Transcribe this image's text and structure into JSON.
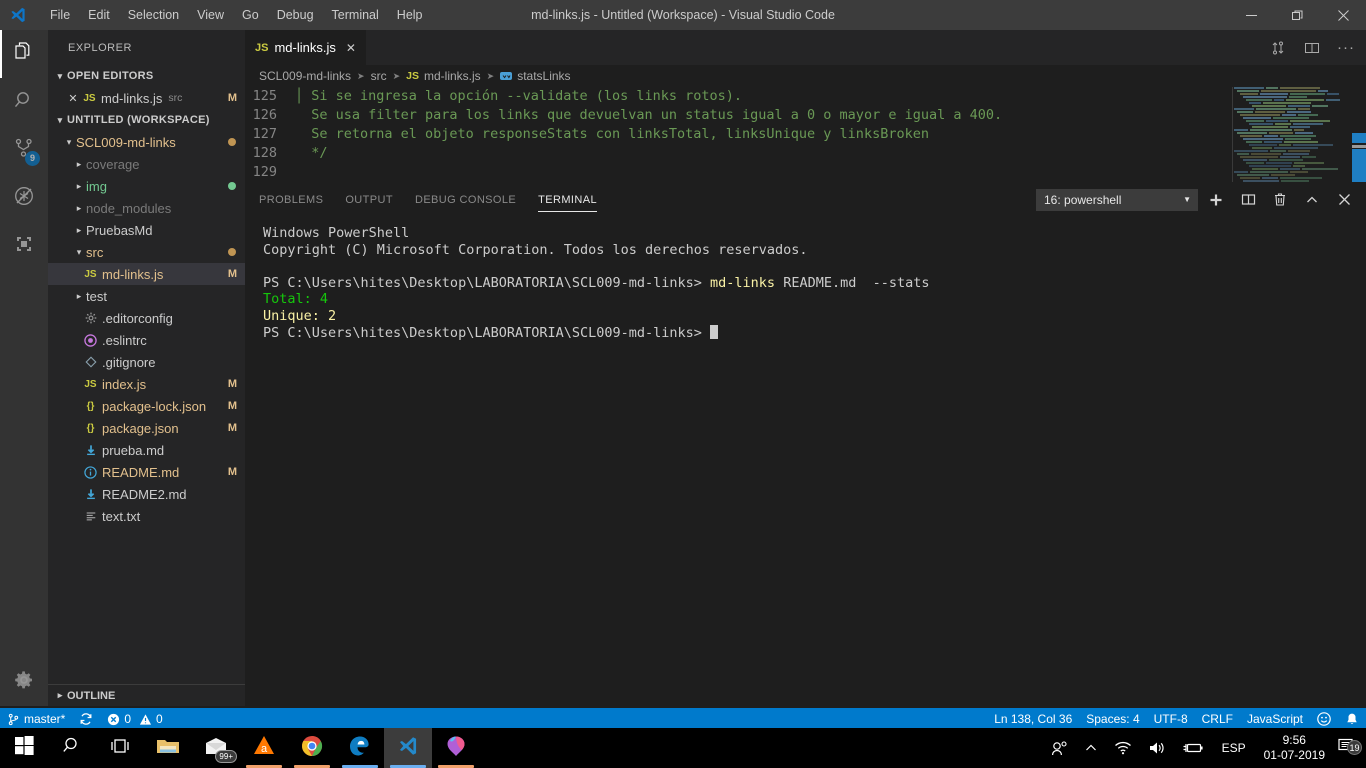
{
  "titlebar": {
    "title": "md-links.js - Untitled (Workspace) - Visual Studio Code",
    "logo_icon": "vscode-logo-icon",
    "menus": [
      "File",
      "Edit",
      "Selection",
      "View",
      "Go",
      "Debug",
      "Terminal",
      "Help"
    ],
    "window_controls": [
      {
        "name": "minimize-button",
        "glyph": "─"
      },
      {
        "name": "maximize-button",
        "glyph": "❐"
      },
      {
        "name": "close-button",
        "glyph": "✕"
      }
    ]
  },
  "activitybar": {
    "items": [
      {
        "name": "explorer",
        "icon": "files-icon",
        "active": true,
        "badge": ""
      },
      {
        "name": "search",
        "icon": "search-icon",
        "active": false,
        "badge": ""
      },
      {
        "name": "source-control",
        "icon": "source-control-icon",
        "active": false,
        "badge": "9"
      },
      {
        "name": "debug",
        "icon": "debug-icon",
        "active": false,
        "badge": ""
      },
      {
        "name": "extensions",
        "icon": "extensions-icon",
        "active": false,
        "badge": ""
      }
    ],
    "settings_icon": "gear-icon"
  },
  "sidebar": {
    "title": "EXPLORER",
    "open_editors": {
      "label": "OPEN EDITORS",
      "items": [
        {
          "icon": "js-file-icon",
          "name": "md-links.js",
          "sub": "src",
          "status": "M"
        }
      ]
    },
    "workspace": {
      "label": "UNTITLED (WORKSPACE)",
      "items": [
        {
          "icon": "folder-open",
          "name": "SCL009-md-links",
          "indent": 1,
          "expanded": true,
          "status": "",
          "dot": "#c09553",
          "color": "#e2c08d",
          "bold": false
        },
        {
          "icon": "folder",
          "name": "coverage",
          "indent": 2,
          "expanded": false,
          "status": "",
          "dot": "",
          "color": "#7a7a7a",
          "bold": false
        },
        {
          "icon": "folder",
          "name": "img",
          "indent": 2,
          "expanded": false,
          "status": "",
          "dot": "#73c991",
          "color": "#73c991",
          "bold": false
        },
        {
          "icon": "folder",
          "name": "node_modules",
          "indent": 2,
          "expanded": false,
          "status": "",
          "dot": "",
          "color": "#7a7a7a",
          "bold": false
        },
        {
          "icon": "folder",
          "name": "PruebasMd",
          "indent": 2,
          "expanded": false,
          "status": "",
          "dot": "",
          "color": "#cccccc",
          "bold": false
        },
        {
          "icon": "folder-open",
          "name": "src",
          "indent": 2,
          "expanded": true,
          "status": "",
          "dot": "#c09553",
          "color": "#e2c08d",
          "bold": false
        },
        {
          "icon": "js-file-icon",
          "name": "md-links.js",
          "indent": 3,
          "expanded": null,
          "status": "M",
          "dot": "",
          "color": "#e2c08d",
          "bold": false,
          "selected": true
        },
        {
          "icon": "folder",
          "name": "test",
          "indent": 2,
          "expanded": false,
          "status": "",
          "dot": "",
          "color": "#cccccc",
          "bold": false
        },
        {
          "icon": "gear-file-icon",
          "name": ".editorconfig",
          "indent": 3,
          "expanded": null,
          "status": "",
          "dot": "",
          "color": "#cccccc",
          "bold": false
        },
        {
          "icon": "eslint-icon",
          "name": ".eslintrc",
          "indent": 3,
          "expanded": null,
          "status": "",
          "dot": "",
          "color": "#cccccc",
          "bold": false
        },
        {
          "icon": "git-icon",
          "name": ".gitignore",
          "indent": 3,
          "expanded": null,
          "status": "",
          "dot": "",
          "color": "#cccccc",
          "bold": false
        },
        {
          "icon": "js-file-icon",
          "name": "index.js",
          "indent": 3,
          "expanded": null,
          "status": "M",
          "dot": "",
          "color": "#e2c08d",
          "bold": false
        },
        {
          "icon": "json-icon",
          "name": "package-lock.json",
          "indent": 3,
          "expanded": null,
          "status": "M",
          "dot": "",
          "color": "#e2c08d",
          "bold": false
        },
        {
          "icon": "json-icon",
          "name": "package.json",
          "indent": 3,
          "expanded": null,
          "status": "M",
          "dot": "",
          "color": "#e2c08d",
          "bold": false
        },
        {
          "icon": "markdown-icon",
          "name": "prueba.md",
          "indent": 3,
          "expanded": null,
          "status": "",
          "dot": "",
          "color": "#cccccc",
          "bold": false
        },
        {
          "icon": "info-icon",
          "name": "README.md",
          "indent": 3,
          "expanded": null,
          "status": "M",
          "dot": "",
          "color": "#e2c08d",
          "bold": false
        },
        {
          "icon": "markdown-icon",
          "name": "README2.md",
          "indent": 3,
          "expanded": null,
          "status": "",
          "dot": "",
          "color": "#cccccc",
          "bold": false
        },
        {
          "icon": "text-file-icon",
          "name": "text.txt",
          "indent": 3,
          "expanded": null,
          "status": "",
          "dot": "",
          "color": "#cccccc",
          "bold": false
        }
      ]
    },
    "outline_label": "OUTLINE"
  },
  "editor": {
    "tab": {
      "icon": "js-file-icon",
      "label": "md-links.js",
      "close": "✕"
    },
    "actions": [
      {
        "name": "split-editor-vertical-icon",
        "glyph": "sync"
      },
      {
        "name": "split-editor-icon",
        "glyph": "split"
      },
      {
        "name": "more-actions-icon",
        "glyph": "···"
      }
    ],
    "breadcrumb": [
      "SCL009-md-links",
      "src",
      "md-links.js",
      "statsLinks"
    ],
    "breadcrumb_file_icon": "js-file-icon",
    "breadcrumb_symbol_icon": "method-symbol-icon",
    "lines": [
      {
        "num": "125",
        "text": "Si se ingresa la opción --validate (los links rotos).",
        "guide": true
      },
      {
        "num": "126",
        "text": "Se usa filter para los links que devuelvan un status igual a 0 o mayor e igual a 400.",
        "guide": false
      },
      {
        "num": "127",
        "text": "Se retorna el objeto responseStats con linksTotal, linksUnique y linksBroken",
        "guide": false
      },
      {
        "num": "128",
        "text": "*/",
        "guide": false
      },
      {
        "num": "129",
        "text": "",
        "guide": false
      }
    ]
  },
  "panel": {
    "tabs": [
      {
        "label": "PROBLEMS",
        "active": false
      },
      {
        "label": "OUTPUT",
        "active": false
      },
      {
        "label": "DEBUG CONSOLE",
        "active": false
      },
      {
        "label": "TERMINAL",
        "active": true
      }
    ],
    "terminal_select": "16: powershell",
    "actions": [
      {
        "name": "new-terminal-button",
        "glyph": "+"
      },
      {
        "name": "split-terminal-button",
        "glyph": "split"
      },
      {
        "name": "kill-terminal-button",
        "glyph": "trash"
      },
      {
        "name": "maximize-panel-button",
        "glyph": "⌃"
      },
      {
        "name": "close-panel-button",
        "glyph": "✕"
      }
    ],
    "terminal_lines": [
      [
        {
          "t": "Windows PowerShell",
          "c": "plain"
        }
      ],
      [
        {
          "t": "Copyright (C) Microsoft Corporation. Todos los derechos reservados.",
          "c": "plain"
        }
      ],
      [
        {
          "t": "",
          "c": "plain"
        }
      ],
      [
        {
          "t": "PS C:\\Users\\hites\\Desktop\\LABORATORIA\\SCL009-md-links> ",
          "c": "plain"
        },
        {
          "t": "md-links",
          "c": "cmd"
        },
        {
          "t": " README.md  --stats",
          "c": "plain"
        }
      ],
      [
        {
          "t": "Total: ",
          "c": "green"
        },
        {
          "t": "4",
          "c": "green"
        }
      ],
      [
        {
          "t": "Unique: ",
          "c": "yellow"
        },
        {
          "t": "2",
          "c": "yellow"
        }
      ],
      [
        {
          "t": "PS C:\\Users\\hites\\Desktop\\LABORATORIA\\SCL009-md-links> ",
          "c": "plain"
        },
        {
          "t": "CURSOR",
          "c": "cursor"
        }
      ]
    ]
  },
  "statusbar": {
    "branch": "master*",
    "branch_icon": "source-control-icon",
    "sync_icon": "sync-icon",
    "errors_icon": "error-icon",
    "errors": "0",
    "warnings_icon": "warning-icon",
    "warnings": "0",
    "position": "Ln 138, Col 36",
    "indent": "Spaces: 4",
    "encoding": "UTF-8",
    "eol": "CRLF",
    "language": "JavaScript",
    "feedback_icon": "smiley-icon",
    "bell_icon": "bell-icon",
    "accent": "#007acc"
  },
  "taskbar": {
    "items": [
      {
        "name": "start-button",
        "icon": "windows-logo-icon",
        "active": false,
        "underline": ""
      },
      {
        "name": "search-taskbar-button",
        "icon": "search-icon",
        "active": false,
        "underline": ""
      },
      {
        "name": "task-view-button",
        "icon": "task-view-icon",
        "active": false,
        "underline": ""
      },
      {
        "name": "file-explorer-button",
        "icon": "folder-icon",
        "active": false,
        "underline": ""
      },
      {
        "name": "mail-button",
        "icon": "mail-icon",
        "active": false,
        "underline": "",
        "badge": "99+"
      },
      {
        "name": "avast-button",
        "icon": "avast-icon",
        "active": false,
        "underline": "#f0a06a"
      },
      {
        "name": "chrome-button",
        "icon": "chrome-icon",
        "active": false,
        "underline": "#f0a06a"
      },
      {
        "name": "edge-button",
        "icon": "edge-icon",
        "active": false,
        "underline": "#6aaef0"
      },
      {
        "name": "vscode-button",
        "icon": "vscode-logo-icon",
        "active": true,
        "underline": "#6aaef0"
      },
      {
        "name": "paint3d-button",
        "icon": "paint3d-icon",
        "active": false,
        "underline": "#f0a06a"
      }
    ],
    "tray": {
      "people_icon": "people-icon",
      "chevron_icon": "show-hidden-icons-icon",
      "network_icon": "wifi-icon",
      "volume_icon": "volume-icon",
      "battery_icon": "battery-charging-icon",
      "language": "ESP",
      "time": "9:56",
      "date": "01-07-2019",
      "notification_icon": "notifications-icon",
      "notification_count": "19"
    }
  }
}
